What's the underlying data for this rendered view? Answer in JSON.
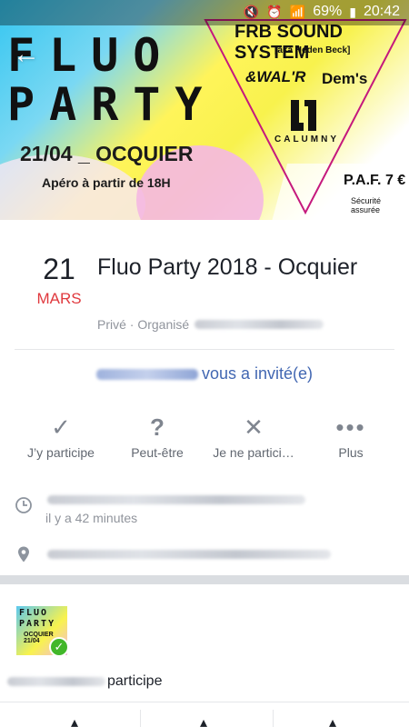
{
  "status_bar": {
    "battery": "69%",
    "time": "20:42"
  },
  "cover": {
    "title_line1": "FLUO",
    "title_line2": "PARTY",
    "date_location": "21/04 _ OCQUIER",
    "apero": "Apéro à partir de 18H",
    "headliner": "FRB SOUND SYSTEM",
    "aka": "[aka Heden Beck]",
    "artist_1": "&WAL'R",
    "artist_2": "Dem's",
    "artist_3": "CALUMNY",
    "price": "P.A.F. 7 €",
    "security": "Sécurité assurée"
  },
  "event": {
    "day": "21",
    "month": "MARS",
    "title": "Fluo Party 2018 - Ocquier",
    "meta_prefix": "Privé · Organisé"
  },
  "invite": {
    "text": "vous a invité(e)"
  },
  "actions": [
    {
      "label": "J’y participe",
      "icon": "check-icon"
    },
    {
      "label": "Peut-être",
      "icon": "question-icon"
    },
    {
      "label": "Je ne partici…",
      "icon": "x-icon"
    },
    {
      "label": "Plus",
      "icon": "more-icon"
    }
  ],
  "details": {
    "time_ago": "il y a 42 minutes"
  },
  "attendee": {
    "thumb_line1": "FLUO",
    "thumb_line2": "PARTY",
    "thumb_line3": "OCQUIER",
    "thumb_line4": "21/04",
    "status_text": "participe"
  },
  "colors": {
    "accent": "#4267b2",
    "month_red": "#e0393e",
    "going_green": "#42b72a"
  }
}
